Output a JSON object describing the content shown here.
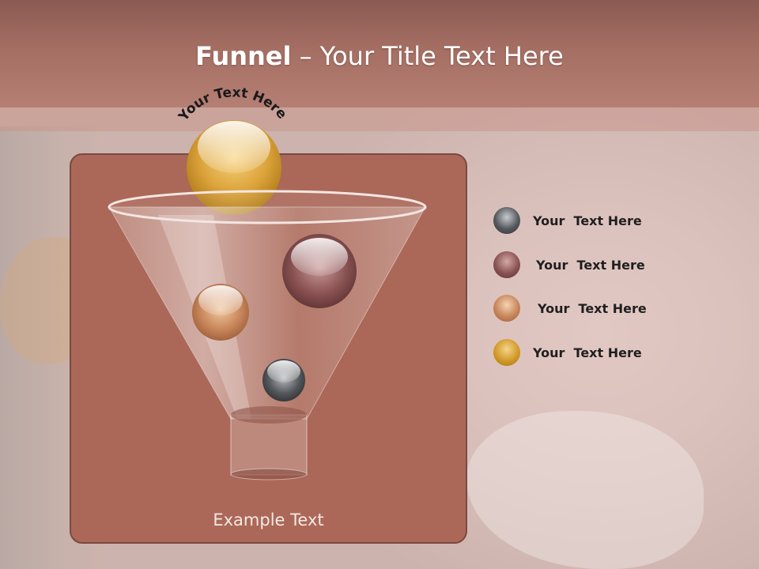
{
  "slide": {
    "title_bold": "Funnel",
    "title_rest": " – Your Title Text Here",
    "arc_text": "Your Text Here",
    "example_text": "Example Text"
  },
  "legend": [
    {
      "label": "Your  Text Here",
      "color": "#4a4d52",
      "icon": "gray-ball-icon"
    },
    {
      "label": "Your  Text Here",
      "color": "#7a4a4a",
      "icon": "maroon-ball-icon"
    },
    {
      "label": "Your  Text Here",
      "color": "#b77a55",
      "icon": "copper-ball-icon"
    },
    {
      "label": "Your  Text Here",
      "color": "#c8901c",
      "icon": "gold-ball-icon"
    }
  ],
  "colors": {
    "header": "#9c6459",
    "panel": "#ab6858",
    "gold": "#d8a032"
  }
}
